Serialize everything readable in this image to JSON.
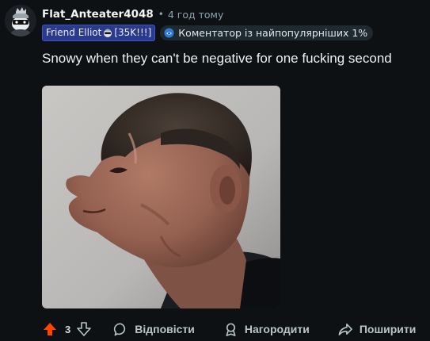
{
  "comment": {
    "author": "Flat_Anteater4048",
    "separator": "•",
    "time": "4 год тому",
    "flair_user_before": "Friend Elliot",
    "flair_user_after": "[35K!!!]",
    "flair_top_commenter": "Коментатор із найпопулярніших 1%",
    "body": "Snowy when they can't be negative for one fucking second",
    "image_alt": "close-up photo of a man in profile"
  },
  "actions": {
    "vote_count": "3",
    "reply_label": "Відповісти",
    "award_label": "Нагородити",
    "share_label": "Поширити"
  },
  "colors": {
    "background": "#0e1113",
    "upvote_active": "#ff4500",
    "flair_bg": "#2a3a8c",
    "text_primary": "#eef1f3",
    "text_muted": "#8ba2ad"
  },
  "icons": {
    "avatar": "snoo-avatar",
    "flair_emoji": "snoo-emoji-icon",
    "top_commenter": "top-commenter-icon",
    "upvote": "upvote-icon",
    "downvote": "downvote-icon",
    "reply": "speech-bubble-icon",
    "award": "award-icon",
    "share": "share-arrow-icon"
  }
}
